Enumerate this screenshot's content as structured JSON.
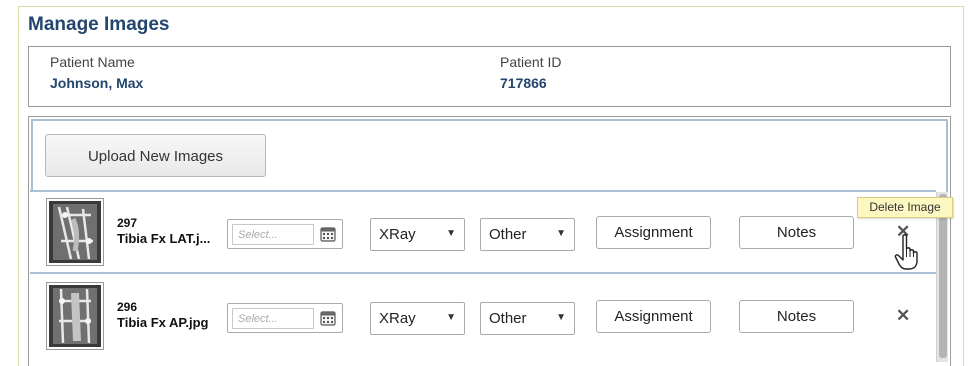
{
  "page": {
    "title": "Manage Images"
  },
  "patient": {
    "name_label": "Patient Name",
    "name_value": "Johnson, Max",
    "id_label": "Patient ID",
    "id_value": "717866"
  },
  "upload_button_label": "Upload New Images",
  "images": [
    {
      "id": "297",
      "filename": "Tibia Fx LAT.j...",
      "date_placeholder": "Select...",
      "type": "XRay",
      "category": "Other",
      "assignment_label": "Assignment",
      "notes_label": "Notes",
      "delete_glyph": "✕"
    },
    {
      "id": "296",
      "filename": "Tibia Fx AP.jpg",
      "date_placeholder": "Select...",
      "type": "XRay",
      "category": "Other",
      "assignment_label": "Assignment",
      "notes_label": "Notes",
      "delete_glyph": "✕"
    }
  ],
  "tooltip": {
    "text": "Delete Image"
  },
  "icons": {
    "calendar": "calendar-icon",
    "caret": "caret-down-icon",
    "delete": "delete-x-icon",
    "cursor": "hand-pointer-cursor-icon"
  },
  "colors": {
    "title": "#24466e",
    "panel_border_accent": "#a9bfd6",
    "tooltip_bg": "#fdf7c2"
  },
  "glyphs": {
    "caret": "▼"
  }
}
